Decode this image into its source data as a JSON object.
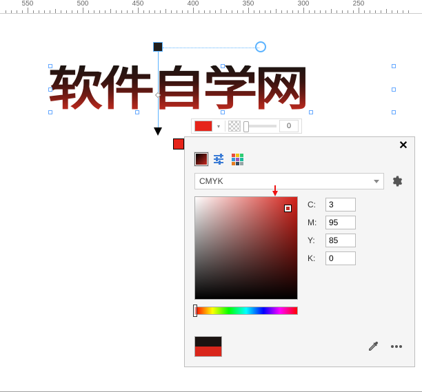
{
  "ruler": {
    "ticks": [
      550,
      500,
      450,
      400,
      350,
      300,
      250
    ]
  },
  "artwork": {
    "text": "软件自学网"
  },
  "mini_toolbar": {
    "opacity_value": "0"
  },
  "panel": {
    "model_label": "CMYK",
    "cmyk": {
      "c_label": "C:",
      "m_label": "M:",
      "y_label": "Y:",
      "k_label": "K:",
      "c": "3",
      "m": "95",
      "y": "85",
      "k": "0"
    }
  },
  "chart_data": {
    "type": "table",
    "title": "CMYK color values",
    "categories": [
      "C",
      "M",
      "Y",
      "K"
    ],
    "values": [
      3,
      95,
      85,
      0
    ]
  }
}
